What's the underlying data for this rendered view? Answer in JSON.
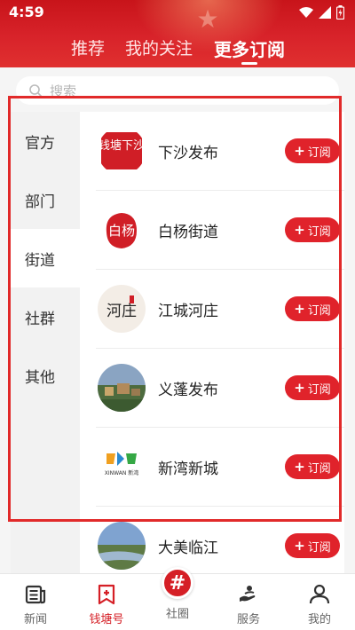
{
  "status": {
    "time": "4:59"
  },
  "top_tabs": [
    {
      "label": "推荐"
    },
    {
      "label": "我的关注"
    },
    {
      "label": "更多订阅"
    }
  ],
  "search": {
    "placeholder": "搜索"
  },
  "sidebar": {
    "items": [
      {
        "label": "官方"
      },
      {
        "label": "部门"
      },
      {
        "label": "街道"
      },
      {
        "label": "社群"
      },
      {
        "label": "其他"
      }
    ],
    "active_index": 2
  },
  "subscribe_label": "订阅",
  "list": [
    {
      "name": "下沙发布",
      "logo_text": "钱塘下沙",
      "logo_style": "seal"
    },
    {
      "name": "白杨街道",
      "logo_text": "白杨",
      "logo_style": "seal"
    },
    {
      "name": "江城河庄",
      "logo_text": "河庄",
      "logo_style": "brush"
    },
    {
      "name": "义蓬发布",
      "logo_text": "",
      "logo_style": "photo"
    },
    {
      "name": "新湾新城",
      "logo_text": "XINWAN 新湾",
      "logo_style": "logo"
    },
    {
      "name": "大美临江",
      "logo_text": "",
      "logo_style": "photo"
    }
  ],
  "bottom_nav": [
    {
      "label": "新闻",
      "icon": "news-icon"
    },
    {
      "label": "钱塘号",
      "icon": "bookmark-plus-icon"
    },
    {
      "label": "社圈",
      "icon": "hashtag-icon"
    },
    {
      "label": "服务",
      "icon": "service-icon"
    },
    {
      "label": "我的",
      "icon": "person-icon"
    }
  ],
  "colors": {
    "brand": "#d51f26",
    "header": "#d8232a"
  }
}
